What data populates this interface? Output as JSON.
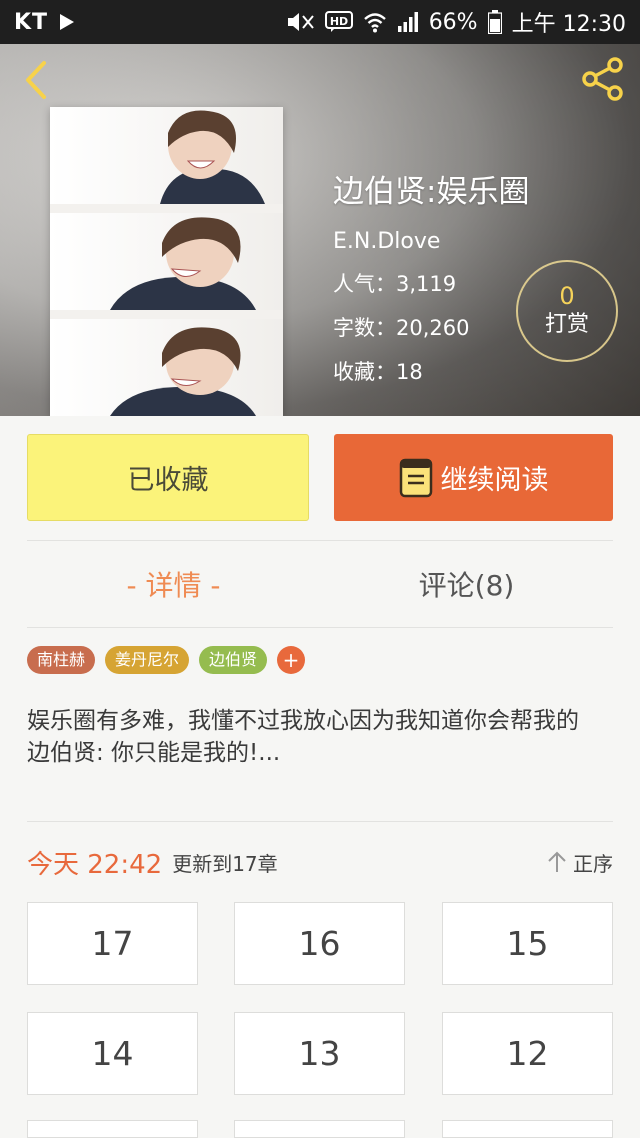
{
  "status_bar": {
    "carrier": "KT",
    "battery": "66%",
    "time": "上午 12:30"
  },
  "book": {
    "title": "边伯贤:娱乐圈",
    "author": "E.N.Dlove",
    "popularity": "人气：3,119",
    "word_count": "字数：20,260",
    "favorites": "收藏：18"
  },
  "tip": {
    "count": "0",
    "label": "打赏"
  },
  "actions": {
    "favorited_label": "已收藏",
    "continue_label": "继续阅读"
  },
  "tabs": {
    "detail": "- 详情 -",
    "comments": "评论(8)"
  },
  "tags": [
    "南柱赫",
    "姜丹尼尔",
    "边伯贤",
    "+"
  ],
  "description": {
    "line1": "娱乐圈有多难，我懂不过我放心因为我知道你会帮我的",
    "line2": "边伯贤: 你只能是我的!..."
  },
  "update": {
    "time": "今天 22:42",
    "text": "更新到17章",
    "sort_label": "正序"
  },
  "chapters": [
    "17",
    "16",
    "15",
    "14",
    "13",
    "12"
  ],
  "colors": {
    "accent": "#e86837",
    "favorite_button": "#fbf37a",
    "tip_count": "#f6d35a"
  }
}
